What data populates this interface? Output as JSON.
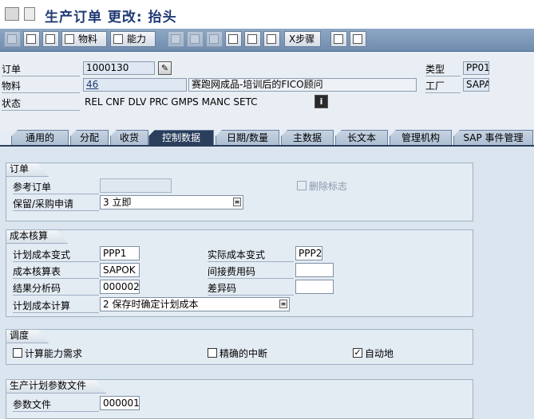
{
  "window": {
    "title": "生产订单 更改: 抬头"
  },
  "toolbar": {
    "material_label": "物料",
    "capacity_label": "能力",
    "steps_label": "X步骤"
  },
  "header": {
    "order_label": "订单",
    "order_value": "1000130",
    "material_label": "物料",
    "material_value": "46",
    "material_desc": "赛跑网成品-培训后的FICO顾问",
    "status_label": "状态",
    "status_value": "REL  CNF  DLV  PRC  GMPS MANC SETC",
    "type_label": "类型",
    "type_value": "PP01",
    "plant_label": "工厂",
    "plant_value": "SAPA"
  },
  "tabs": [
    "通用的",
    "分配",
    "收货",
    "控制数据",
    "日期/数量",
    "主数据",
    "长文本",
    "管理机构",
    "SAP 事件管理"
  ],
  "active_tab": "控制数据",
  "order_group": {
    "title": "订单",
    "ref_order_label": "参考订单",
    "ref_order_value": "",
    "deletion_flag_label": "删除标志",
    "reservation_label": "保留/采购申请",
    "reservation_value": "3 立即"
  },
  "costing_group": {
    "title": "成本核算",
    "planned_variant_label": "计划成本变式",
    "planned_variant_value": "PPP1",
    "actual_variant_label": "实际成本变式",
    "actual_variant_value": "PPP2",
    "costing_sheet_label": "成本核算表",
    "costing_sheet_value": "SAPOK",
    "overhead_key_label": "间接费用码",
    "overhead_key_value": "",
    "ra_key_label": "结果分析码",
    "ra_key_value": "000002",
    "variance_key_label": "差异码",
    "variance_key_value": "",
    "plan_cost_calc_label": "计划成本计算",
    "plan_cost_calc_value": "2 保存时确定计划成本"
  },
  "scheduling_group": {
    "title": "调度",
    "capacity_req_label": "计算能力需求",
    "capacity_req_checked": false,
    "exact_break_label": "精确的中断",
    "exact_break_checked": false,
    "automatic_label": "自动地",
    "automatic_checked": true
  },
  "profile_group": {
    "title": "生产计划参数文件",
    "profile_label": "参数文件",
    "profile_value": "000001"
  }
}
